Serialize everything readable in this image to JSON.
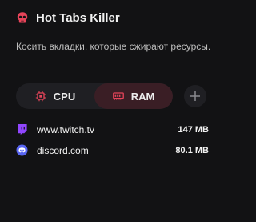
{
  "app": {
    "title": "Hot Tabs Killer",
    "icon": "skull-icon",
    "accent_color": "#e8445a",
    "subtitle": "Косить вкладки, которые сжирают ресурсы."
  },
  "toggle": {
    "options": [
      {
        "label": "CPU",
        "icon": "cpu-chip-icon",
        "active": false
      },
      {
        "label": "RAM",
        "icon": "ram-memory-icon",
        "active": true
      }
    ],
    "add_icon": "plus-icon"
  },
  "tabs": [
    {
      "site": "www.twitch.tv",
      "size": "147 MB",
      "icon": "twitch-icon",
      "icon_color": "#9146ff"
    },
    {
      "site": "discord.com",
      "size": "80.1 MB",
      "icon": "discord-icon",
      "icon_color": "#5865f2"
    }
  ]
}
